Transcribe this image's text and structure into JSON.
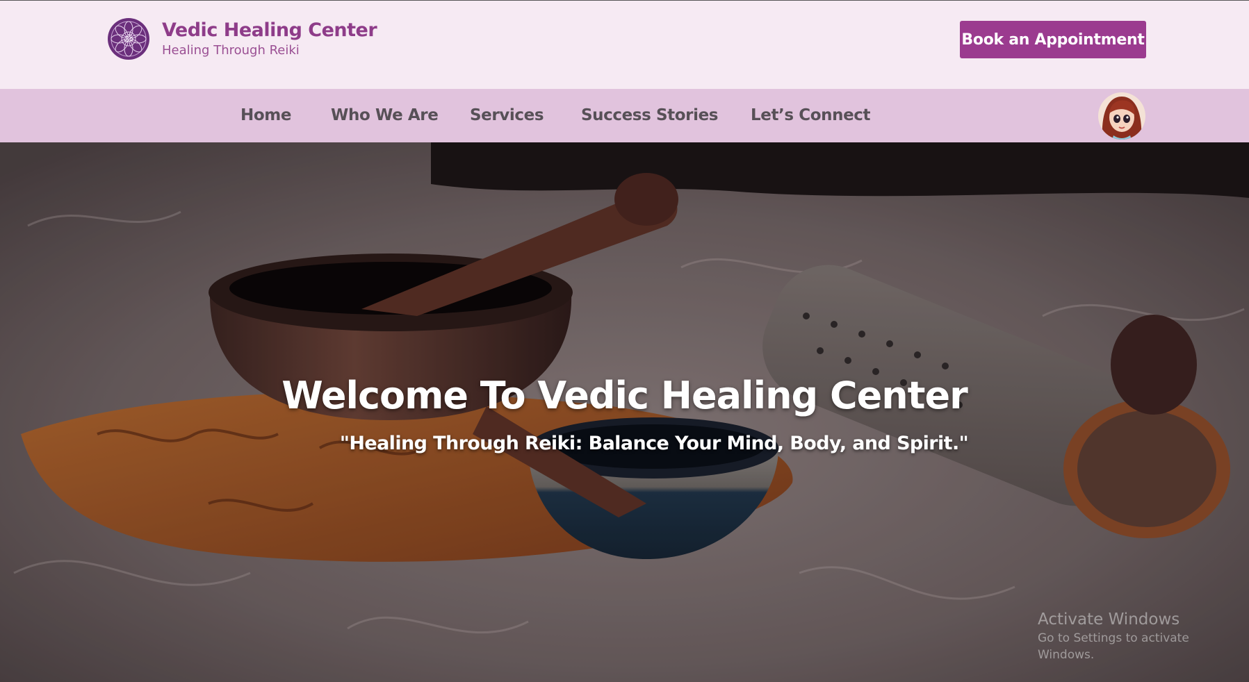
{
  "header": {
    "brand_title": "Vedic Healing Center",
    "brand_subtitle": "Healing Through Reiki",
    "book_button": "Book an Appointment",
    "logo_icon": "lotus-mandala-icon"
  },
  "nav": {
    "items": [
      {
        "label": "Home"
      },
      {
        "label": "Who We Are"
      },
      {
        "label": "Services"
      },
      {
        "label": "Success Stories"
      },
      {
        "label": "Let’s Connect"
      }
    ],
    "avatar_icon": "user-avatar"
  },
  "hero": {
    "title": "Welcome To Vedic Healing Center",
    "subtitle": "\"Healing Through Reiki: Balance Your Mind, Body, and Spirit.\"",
    "image_subject": "singing-bowls-on-fur-photo"
  },
  "watermark": {
    "title": "Activate Windows",
    "subtitle": "Go to Settings to activate Windows."
  },
  "colors": {
    "topbar_bg": "#f6eaf3",
    "nav_bg": "#e1c3dd",
    "brand": "#8e3c89",
    "button": "#9b3b8f",
    "nav_text": "#575057"
  }
}
